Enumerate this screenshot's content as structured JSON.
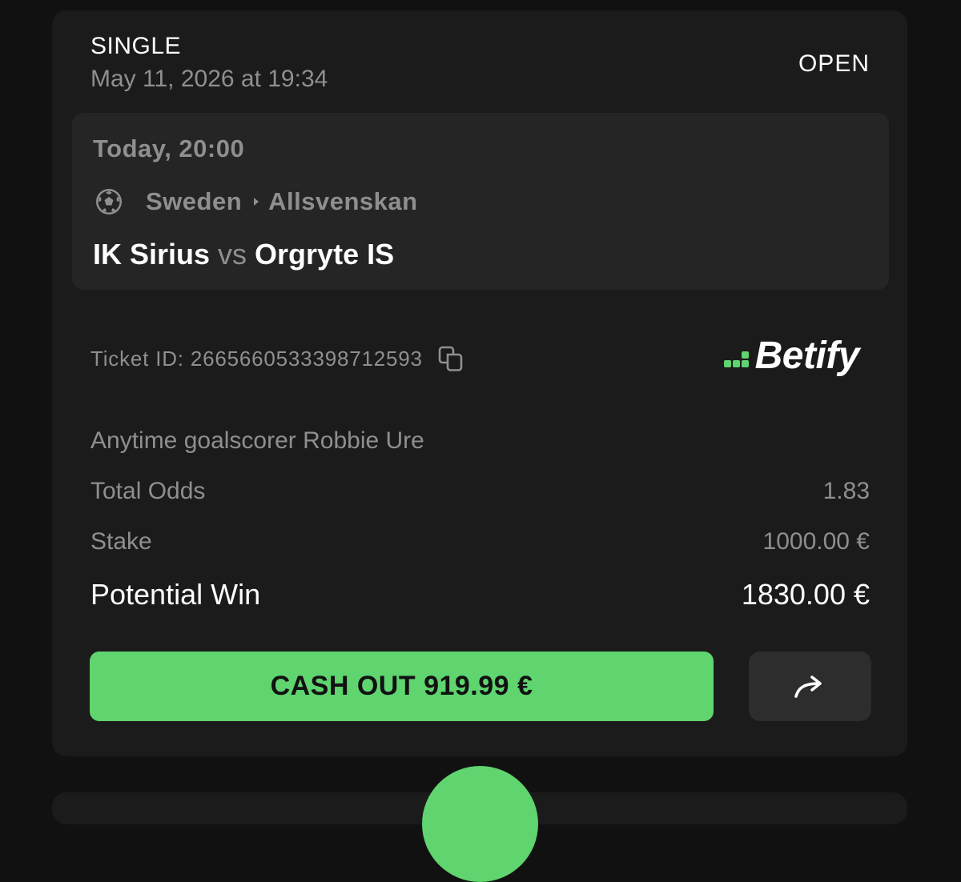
{
  "ticket": {
    "type": "SINGLE",
    "placed_at": "May 11, 2026 at 19:34",
    "status": "OPEN"
  },
  "event": {
    "time": "Today, 20:00",
    "sport_icon": "soccer-ball-icon",
    "country": "Sweden",
    "league": "Allsvenskan",
    "home_team": "IK Sirius",
    "vs_label": "vs",
    "away_team": "Orgryte IS"
  },
  "ticket_id": {
    "text": "Ticket ID: 2665660533398712593",
    "copy_icon": "copy-icon"
  },
  "brand": {
    "name": "Betify",
    "accent_color": "#5fd46f"
  },
  "details": {
    "selection": "Anytime goalscorer Robbie Ure",
    "total_odds_label": "Total Odds",
    "total_odds_value": "1.83",
    "stake_label": "Stake",
    "stake_value": "1000.00 €",
    "potential_win_label": "Potential Win",
    "potential_win_value": "1830.00 €"
  },
  "actions": {
    "cashout_label": "CASH OUT 919.99 €",
    "share_icon": "share-arrow-icon"
  }
}
